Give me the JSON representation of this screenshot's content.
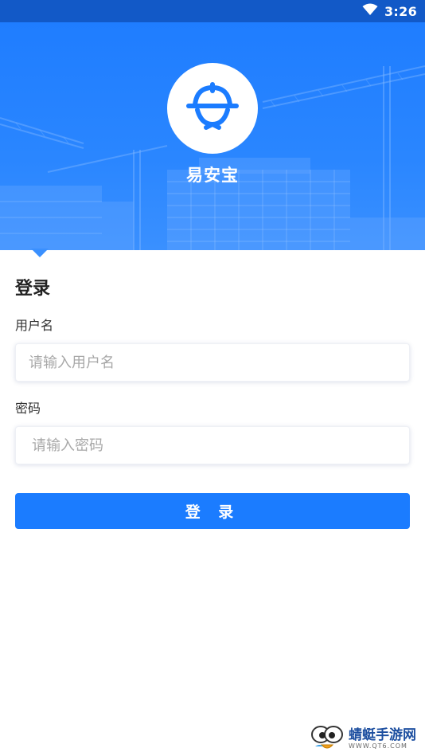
{
  "status_bar": {
    "time": "3:26",
    "wifi_icon": "wifi-icon",
    "battery_icon": "battery-icon"
  },
  "banner": {
    "app_name": "易安宝",
    "logo_icon": "hard-hat-icon",
    "background_color": "#2a86ff"
  },
  "login_form": {
    "title": "登录",
    "username": {
      "label": "用户名",
      "placeholder": "请输入用户名",
      "value": ""
    },
    "password": {
      "label": "密码",
      "placeholder": "请输入密码",
      "value": ""
    },
    "submit_label": "登 录",
    "accent_color": "#1b7cff"
  },
  "watermark": {
    "name": "蜻蜓手游网",
    "url": "WWW.QT6.COM"
  }
}
